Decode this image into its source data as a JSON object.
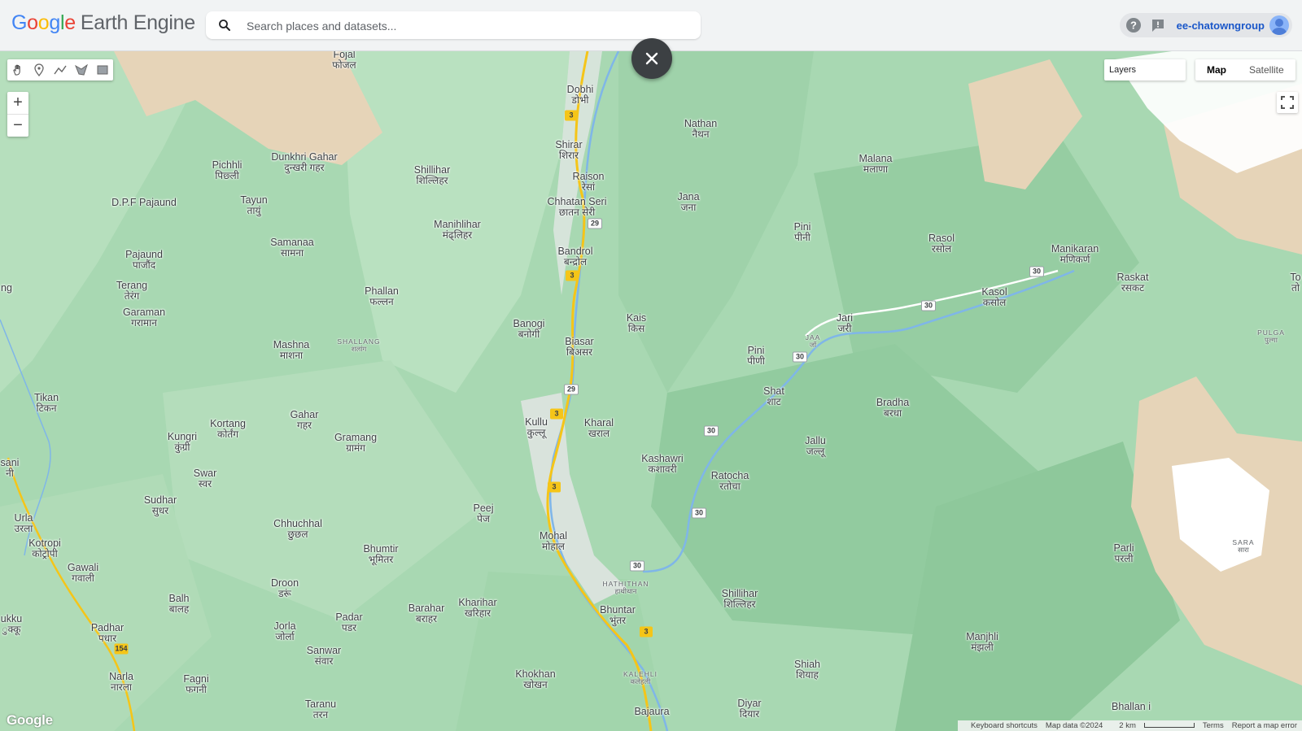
{
  "header": {
    "brand_letters": [
      "G",
      "o",
      "o",
      "g",
      "l",
      "e"
    ],
    "product": "Earth Engine",
    "search_placeholder": "Search places and datasets...",
    "account": "ee-chatowngroup"
  },
  "icons": {
    "search": "search-icon",
    "help": "help-icon",
    "feedback": "feedback-icon",
    "avatar": "avatar-icon",
    "close": "close-icon",
    "fullscreen": "fullscreen-icon",
    "tools": [
      "hand-icon",
      "point-icon",
      "line-icon",
      "polygon-icon",
      "rectangle-icon"
    ]
  },
  "map_controls": {
    "zoom_in": "+",
    "zoom_out": "−",
    "layers_label": "Layers",
    "map_type_options": [
      "Map",
      "Satellite"
    ],
    "selected_map_type": "Map",
    "google_logo": "Google"
  },
  "footer": {
    "keyboard_shortcuts": "Keyboard shortcuts",
    "map_data": "Map data ©2024",
    "scale": "2 km",
    "terms": "Terms",
    "report": "Report a map error"
  },
  "places": [
    {
      "en": "Fojal",
      "dv": "फोजल"
    },
    {
      "en": "Dobhi",
      "dv": "डोभी"
    },
    {
      "en": "Nathan",
      "dv": "नैथन"
    },
    {
      "en": "Shirar",
      "dv": "शिरार"
    },
    {
      "en": "Raison",
      "dv": "रेसां"
    },
    {
      "en": "Chhatan Seri",
      "dv": "छातन सेरी"
    },
    {
      "en": "Jana",
      "dv": "जना"
    },
    {
      "en": "Malana",
      "dv": "मलाणा"
    },
    {
      "en": "Pichhli",
      "dv": "पिछ्ली"
    },
    {
      "en": "Dunkhri Gahar",
      "dv": "दुन्खरी गहर"
    },
    {
      "en": "Shillihar",
      "dv": "शिल्लिहर"
    },
    {
      "en": "D.P.F Pajaund",
      "dv": ""
    },
    {
      "en": "Tayun",
      "dv": "तायुं"
    },
    {
      "en": "Manihlihar",
      "dv": "मंढ्लिहर"
    },
    {
      "en": "Pini",
      "dv": "पीनी"
    },
    {
      "en": "Rasol",
      "dv": "रसोल"
    },
    {
      "en": "Manikaran",
      "dv": "मणिकर्ण"
    },
    {
      "en": "Samanaa",
      "dv": "सामना"
    },
    {
      "en": "Bandrol",
      "dv": "बन्द्रोल"
    },
    {
      "en": "Pajaund",
      "dv": "पाजौंद"
    },
    {
      "en": "Raskat",
      "dv": "रसकट"
    },
    {
      "en": "Terang",
      "dv": "तेरंग"
    },
    {
      "en": "Phallan",
      "dv": "फल्लन"
    },
    {
      "en": "Kasol",
      "dv": "कसोल"
    },
    {
      "en": "Garaman",
      "dv": "गरामान"
    },
    {
      "en": "Banogi",
      "dv": "बनोगी"
    },
    {
      "en": "Kais",
      "dv": "किस"
    },
    {
      "en": "Jari",
      "dv": "जरी"
    },
    {
      "en": "Mashna",
      "dv": "माशना"
    },
    {
      "en": "Biasar",
      "dv": "बिअसर"
    },
    {
      "en": "Pini",
      "dv": "पीणी"
    },
    {
      "en": "Tikan",
      "dv": "टिकन"
    },
    {
      "en": "Shat",
      "dv": "शाट"
    },
    {
      "en": "Bradha",
      "dv": "बरधा"
    },
    {
      "en": "Gahar",
      "dv": "गहर"
    },
    {
      "en": "Kullu",
      "dv": "कुल्लू"
    },
    {
      "en": "Kharal",
      "dv": "खराल"
    },
    {
      "en": "Kortang",
      "dv": "कोर्तंग"
    },
    {
      "en": "Kungri",
      "dv": "कुंग्री"
    },
    {
      "en": "Gramang",
      "dv": "ग्रामंग"
    },
    {
      "en": "Jallu",
      "dv": "जल्लू"
    },
    {
      "en": "Kashawri",
      "dv": "कशावरी"
    },
    {
      "en": "Swar",
      "dv": "स्वर"
    },
    {
      "en": "Ratocha",
      "dv": "रतोचा"
    },
    {
      "en": "Sudhar",
      "dv": "सुधर"
    },
    {
      "en": "Peej",
      "dv": "पेज"
    },
    {
      "en": "Chhuchhal",
      "dv": "छुछल"
    },
    {
      "en": "Urla",
      "dv": "उरला"
    },
    {
      "en": "Kotropi",
      "dv": "कोट्रोपी"
    },
    {
      "en": "Mohal",
      "dv": "मोहाल"
    },
    {
      "en": "Bhumtir",
      "dv": "भूमितर"
    },
    {
      "en": "Parli",
      "dv": "परली"
    },
    {
      "en": "Gawali",
      "dv": "गवाली"
    },
    {
      "en": "Droon",
      "dv": "डरूं"
    },
    {
      "en": "Shillihar",
      "dv": "शिल्लिहर"
    },
    {
      "en": "Balh",
      "dv": "बालह"
    },
    {
      "en": "Kharihar",
      "dv": "खरिहार"
    },
    {
      "en": "Barahar",
      "dv": "बराहर"
    },
    {
      "en": "Bhuntar",
      "dv": "भुंतर"
    },
    {
      "en": "Padar",
      "dv": "पडर"
    },
    {
      "en": "Jorla",
      "dv": "जोर्ला"
    },
    {
      "en": "Padhar",
      "dv": "पधार"
    },
    {
      "en": "Manjhli",
      "dv": "मंझली"
    },
    {
      "en": "Sanwar",
      "dv": "संवार"
    },
    {
      "en": "Shiah",
      "dv": "शियाह"
    },
    {
      "en": "Khokhan",
      "dv": "खोखन"
    },
    {
      "en": "Narla",
      "dv": "नारला"
    },
    {
      "en": "Fagni",
      "dv": "फगनी"
    },
    {
      "en": "Taranu",
      "dv": "तरन"
    },
    {
      "en": "Diyar",
      "dv": "दियार"
    },
    {
      "en": "Bajaura",
      "dv": ""
    },
    {
      "en": "Bhallan i",
      "dv": ""
    },
    {
      "en": "ng",
      "dv": ""
    },
    {
      "en": "sani",
      "dv": "नी"
    },
    {
      "en": "ukku",
      "dv": "ुक्कू"
    },
    {
      "en": "To",
      "dv": "तो"
    }
  ],
  "areas": [
    {
      "en": "SHALLANG",
      "dv": "शलांग"
    },
    {
      "en": "JAA",
      "dv": "जॉ"
    },
    {
      "en": "PULGA",
      "dv": "पुल्गा"
    },
    {
      "en": "HATHITHAN",
      "dv": "हाथीथान"
    },
    {
      "en": "KALEHLI",
      "dv": "कलेहली"
    },
    {
      "en": "SARA",
      "dv": "सारा"
    }
  ],
  "road_shields": [
    {
      "label": "3",
      "kind": "state"
    },
    {
      "label": "3",
      "kind": "state"
    },
    {
      "label": "3",
      "kind": "state"
    },
    {
      "label": "3",
      "kind": "state"
    },
    {
      "label": "3",
      "kind": "state"
    },
    {
      "label": "29",
      "kind": "national"
    },
    {
      "label": "29",
      "kind": "national"
    },
    {
      "label": "30",
      "kind": "national"
    },
    {
      "label": "30",
      "kind": "national"
    },
    {
      "label": "30",
      "kind": "national"
    },
    {
      "label": "30",
      "kind": "national"
    },
    {
      "label": "30",
      "kind": "national"
    },
    {
      "label": "30",
      "kind": "national"
    },
    {
      "label": "154",
      "kind": "state"
    }
  ],
  "colors": {
    "terrain_base": "#a8d8b2",
    "forest_dark": "#8fcc9c",
    "forest_light": "#bfe3c4",
    "high_terrain": "#e8d7bd",
    "snow": "#ffffff",
    "river": "#7fb6e8",
    "highway": "#f5c518"
  }
}
